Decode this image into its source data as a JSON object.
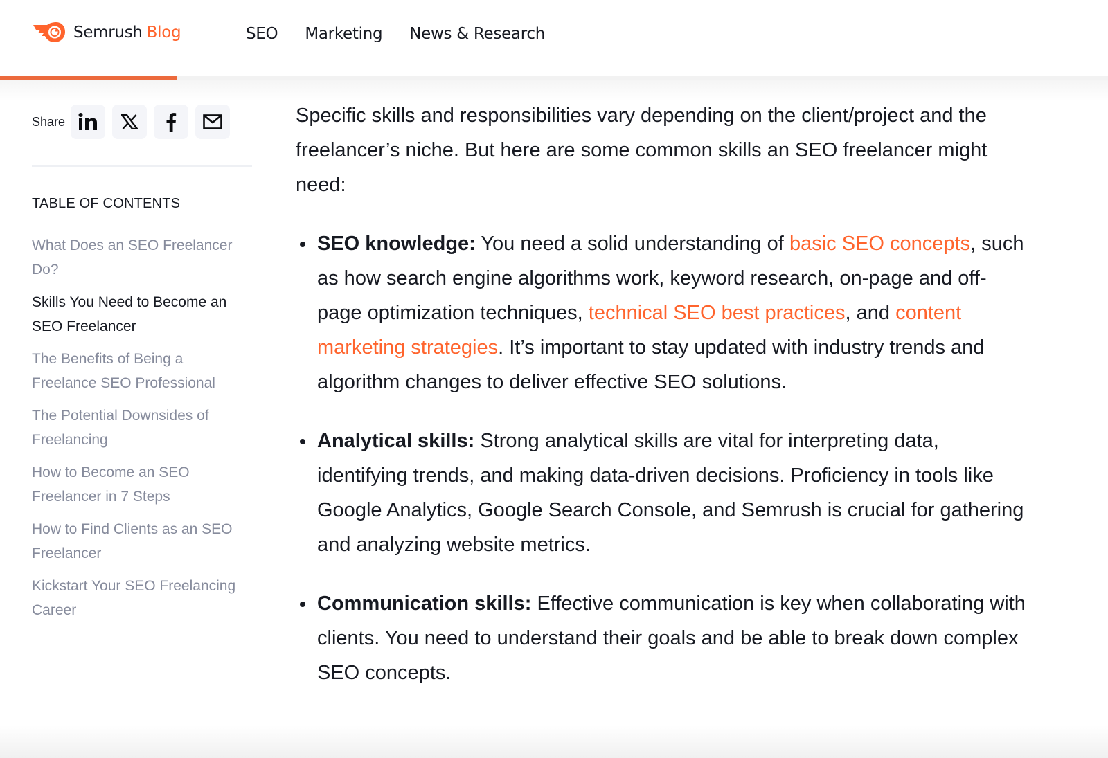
{
  "header": {
    "logo_icon": "semrush-comet-icon",
    "brand": "Semrush",
    "blog": "Blog",
    "nav": [
      "SEO",
      "Marketing",
      "News & Research"
    ],
    "reading_progress_percent": 16
  },
  "colors": {
    "accent": "#ff642d",
    "text": "#171a22",
    "muted": "#868b9c"
  },
  "sidebar": {
    "share_label": "Share",
    "share_buttons": [
      {
        "name": "linkedin-icon"
      },
      {
        "name": "x-icon"
      },
      {
        "name": "facebook-icon"
      },
      {
        "name": "email-icon"
      }
    ],
    "toc_title": "TABLE OF CONTENTS",
    "toc_items": [
      {
        "label": "What Does an SEO Freelancer Do?",
        "active": false
      },
      {
        "label": "Skills You Need to Become an SEO Freelancer",
        "active": true
      },
      {
        "label": "The Benefits of Being a Freelance SEO Professional",
        "active": false
      },
      {
        "label": "The Potential Downsides of Freelancing",
        "active": false
      },
      {
        "label": "How to Become an SEO Freelancer in 7 Steps",
        "active": false
      },
      {
        "label": "How to Find Clients as an SEO Freelancer",
        "active": false
      },
      {
        "label": "Kickstart Your SEO Freelancing Career",
        "active": false
      }
    ]
  },
  "article": {
    "intro": "Specific skills and responsibilities vary depending on the client/project and the freelancer’s niche. But here are some common skills an SEO freelancer might need:",
    "bullets": [
      {
        "title": "SEO knowledge:",
        "t1": " You need a solid understanding of ",
        "link1": "basic SEO concepts",
        "t2": ", such as how search engine algorithms work, keyword research, on-page and off-page optimization techniques, ",
        "link2": "technical SEO best practices",
        "t3": ", and ",
        "link3": "content marketing strategies",
        "t4": ". It’s important to stay updated with industry trends and algorithm changes to deliver effective SEO solutions."
      },
      {
        "title": "Analytical skills:",
        "text": " Strong analytical skills are vital for interpreting data, identifying trends, and making data-driven decisions. Proficiency in tools like Google Analytics, Google Search Console, and Semrush is crucial for gathering and analyzing website metrics."
      },
      {
        "title": "Communication skills:",
        "text": " Effective communication is key when collaborating with clients. You need to understand their goals and be able to break down complex SEO concepts."
      }
    ]
  }
}
